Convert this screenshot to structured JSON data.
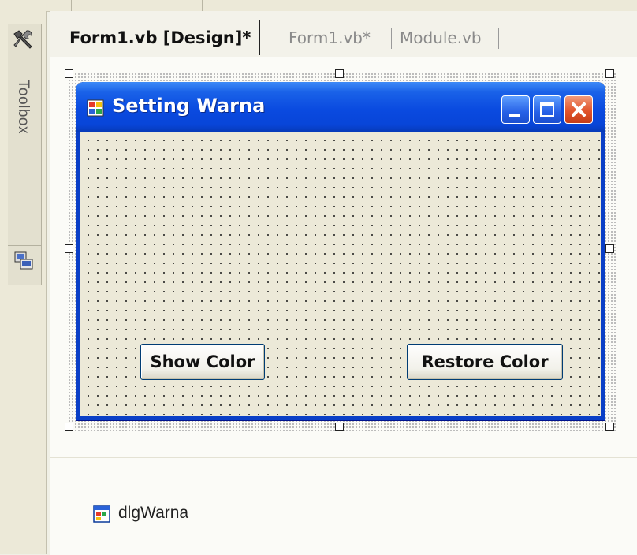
{
  "toolbox": {
    "label": "Toolbox",
    "icons": [
      "hammer-wrench-icon",
      "server-explorer-icon"
    ]
  },
  "tabs": [
    {
      "label": "Form1.vb [Design]*",
      "active": true
    },
    {
      "label": "Form1.vb*",
      "active": false
    },
    {
      "label": "Module.vb",
      "active": false
    }
  ],
  "form": {
    "title": "Setting Warna",
    "title_icon": "form-app-icon",
    "controls": [
      "minimize",
      "maximize",
      "close"
    ],
    "buttons": {
      "show_color": "Show Color",
      "restore_color": "Restore Color"
    }
  },
  "component_tray": {
    "items": [
      {
        "label": "dlgWarna",
        "icon": "color-dialog-icon"
      }
    ]
  },
  "colors": {
    "titlebar": "#0a4ae0",
    "client": "#ece9d8",
    "close_button": "#e1542c"
  }
}
